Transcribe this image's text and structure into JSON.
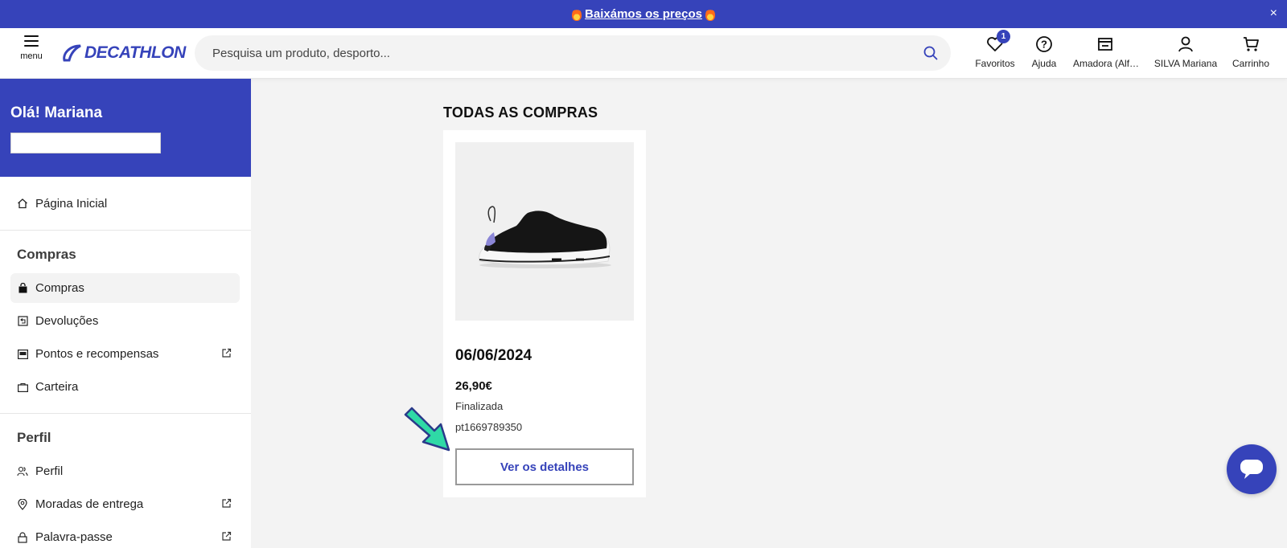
{
  "promo": {
    "text": "Baixámos os preços",
    "close": "×"
  },
  "header": {
    "menu_label": "menu",
    "logo_text": "DECATHLON",
    "search_placeholder": "Pesquisa um produto, desporto...",
    "favorites": {
      "label": "Favoritos",
      "count": "1"
    },
    "help_label": "Ajuda",
    "store_label": "Amadora (Alf…",
    "account_label": "SILVA Mariana",
    "cart_label": "Carrinho"
  },
  "sidebar": {
    "greeting": "Olá! Mariana",
    "home": "Página Inicial",
    "purchases_section": {
      "title": "Compras",
      "items": [
        "Compras",
        "Devoluções",
        "Pontos e recompensas",
        "Carteira"
      ]
    },
    "profile_section": {
      "title": "Perfil",
      "items": [
        "Perfil",
        "Moradas de entrega",
        "Palavra-passe"
      ]
    }
  },
  "main": {
    "title": "TODAS AS COMPRAS",
    "order": {
      "date": "06/06/2024",
      "price": "26,90€",
      "status": "Finalizada",
      "number": "pt1669789350",
      "details_button": "Ver os detalhes"
    }
  },
  "colors": {
    "brand": "#3643ba",
    "arrow": "#2fd9a6"
  }
}
